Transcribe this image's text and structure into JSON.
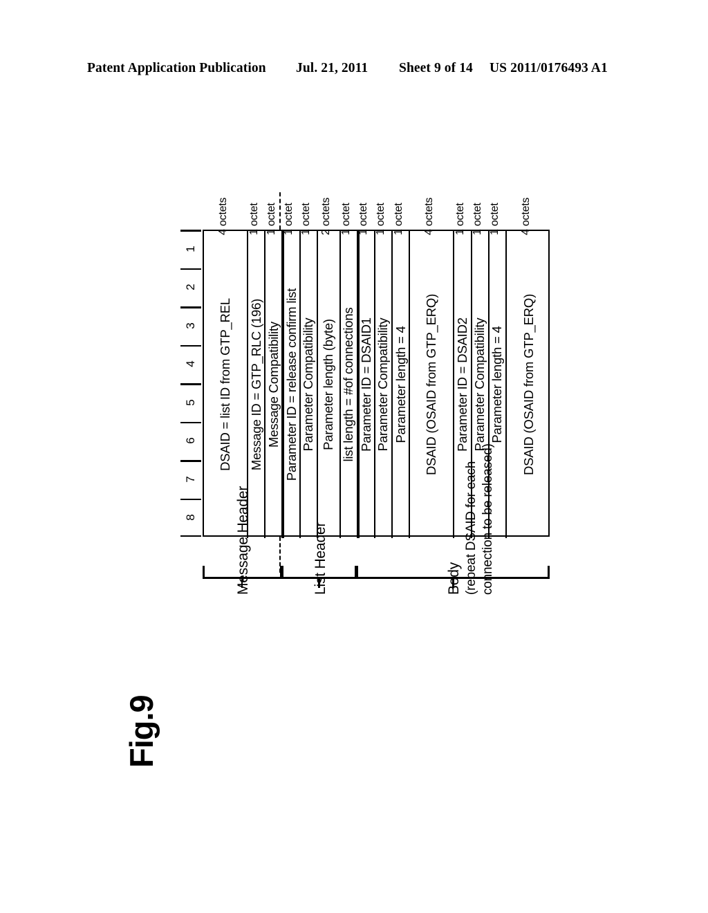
{
  "header": {
    "publication": "Patent Application Publication",
    "date": "Jul. 21, 2011",
    "sheet": "Sheet 9 of 14",
    "document_number": "US 2011/0176493 A1"
  },
  "figure": {
    "label": "Fig.9"
  },
  "bit_ruler": {
    "ticks": [
      "1",
      "2",
      "3",
      "4",
      "5",
      "6",
      "7",
      "8"
    ]
  },
  "fields": [
    {
      "label": "DSAID = list ID from GTP_REL",
      "size": "4 octets",
      "group": "message_header"
    },
    {
      "label": "Message ID = GTP_RLC (196)",
      "size": "1 octet",
      "group": "message_header"
    },
    {
      "label": "Message Compatibility",
      "size": "1 octet",
      "group": "message_header"
    },
    {
      "label": "Parameter ID = release confirm list",
      "size": "1 octet",
      "group": "list_header"
    },
    {
      "label": "Parameter Compatibility",
      "size": "1 octet",
      "group": "list_header"
    },
    {
      "label": "Parameter length (byte)",
      "size": "2 octets",
      "group": "list_header"
    },
    {
      "label": "list length = #of connections",
      "size": "1 octet",
      "group": "list_header"
    },
    {
      "label": "Parameter ID = DSAID1",
      "size": "1 octet",
      "group": "body"
    },
    {
      "label": "Parameter Compatibility",
      "size": "1 octet",
      "group": "body"
    },
    {
      "label": "Parameter length = 4",
      "size": "1 octet",
      "group": "body"
    },
    {
      "label": "DSAID (OSAID from GTP_ERQ)",
      "size": "4 octets",
      "group": "body"
    },
    {
      "label": "Parameter ID = DSAID2",
      "size": "1 octet",
      "group": "body"
    },
    {
      "label": "Parameter Compatibility",
      "size": "1 octet",
      "group": "body"
    },
    {
      "label": "Parameter length = 4",
      "size": "1 octet",
      "group": "body"
    },
    {
      "label": "DSAID (OSAID from GTP_ERQ)",
      "size": "4 octets",
      "group": "body"
    }
  ],
  "groups": [
    {
      "id": "message_header",
      "label": "Message Header",
      "sublabel": ""
    },
    {
      "id": "list_header",
      "label": "List Header",
      "sublabel": ""
    },
    {
      "id": "body",
      "label": "Body",
      "sublabel_line1": "(repeat DSAID for each",
      "sublabel_line2": "connection to be released)"
    }
  ]
}
